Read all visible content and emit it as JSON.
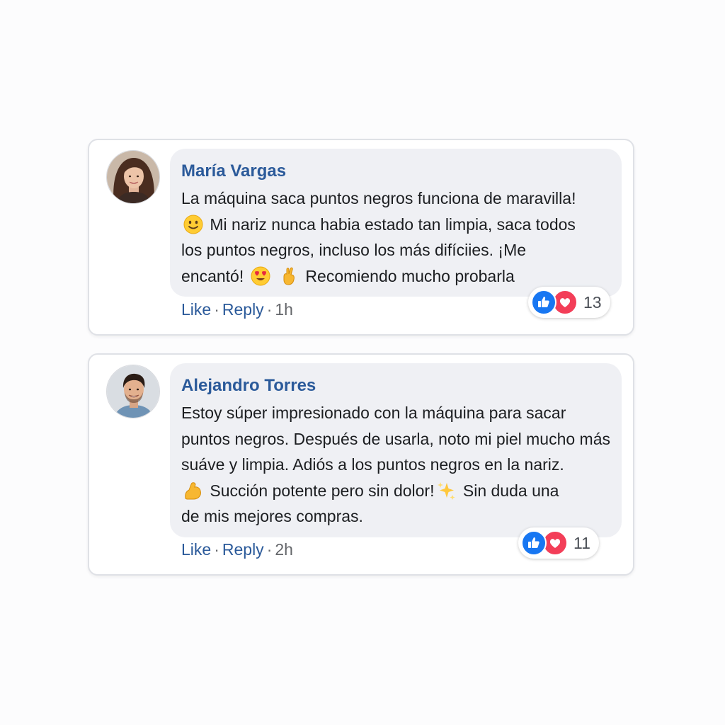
{
  "comments": [
    {
      "author": "María Vargas",
      "avatar_icon": "woman-avatar",
      "lines": [
        [
          "La máquina saca puntos negros funciona de maravilla!"
        ],
        [
          "",
          " Mi nariz nunca habia estado tan limpia, saca todos"
        ],
        [
          "los puntos negros, incluso los más difíciies. ¡Me"
        ],
        [
          "encantó! ",
          " ",
          " Recomiendo mucho probarla"
        ]
      ],
      "emojis": [
        "slightly-smiling-face-emoji",
        "heart-eyes-emoji",
        "crossed-fingers-emoji"
      ],
      "like_label": "Like",
      "reply_label": "Reply",
      "separator": "·",
      "time": "1h",
      "reaction_icons": [
        "like-reaction-icon",
        "love-reaction-icon"
      ],
      "reaction_count": "13"
    },
    {
      "author": "Alejandro Torres",
      "avatar_icon": "man-avatar",
      "lines": [
        [
          "Estoy súper impresionado con la máquina para sacar"
        ],
        [
          "puntos negros. Después de usarla, noto mi piel mucho más"
        ],
        [
          "suáve y limpia. Adiós a los puntos negros en la nariz."
        ],
        [
          "",
          " Succión potente pero sin dolor!",
          " Sin duda una"
        ],
        [
          "de mis mejores compras."
        ]
      ],
      "emojis": [
        "flexed-biceps-emoji",
        "sparkles-emoji"
      ],
      "like_label": "Like",
      "reply_label": "Reply",
      "separator": "·",
      "time": "2h",
      "reaction_icons": [
        "like-reaction-icon",
        "love-reaction-icon"
      ],
      "reaction_count": "11"
    }
  ],
  "colors": {
    "author_name": "#2b5a9a",
    "action_link": "#2b5a9a",
    "bubble": "#eff0f4",
    "like_reaction": "#1877f2",
    "love_reaction": "#f33e58"
  }
}
